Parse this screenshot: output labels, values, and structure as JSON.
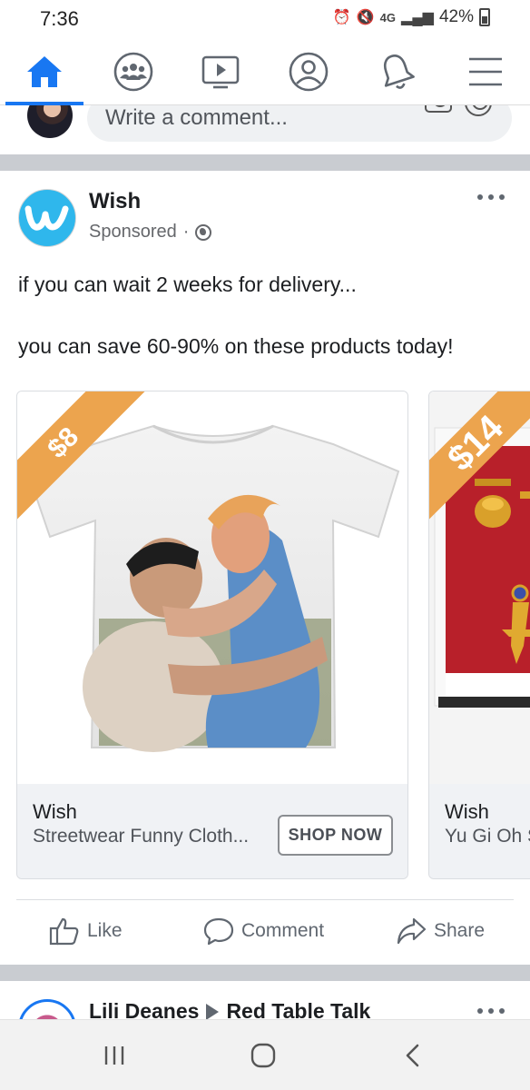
{
  "status_bar": {
    "time": "7:36",
    "network": "4G",
    "battery": "42%"
  },
  "nav": {
    "active": "home",
    "items": [
      "home-icon",
      "groups-icon",
      "watch-icon",
      "profile-icon",
      "notifications-icon",
      "menu-icon"
    ]
  },
  "comment_box": {
    "placeholder": "Write a comment..."
  },
  "post": {
    "page_name": "Wish",
    "sponsored": "Sponsored",
    "text_line1": "if you can wait 2 weeks for delivery...",
    "text_line2": "you can save 60-90% on these products today!",
    "cards": [
      {
        "price": "$8",
        "brand": "Wish",
        "title": "Streetwear Funny Cloth...",
        "cta": "SHOP NOW"
      },
      {
        "price": "$14",
        "brand": "Wish",
        "title": "Yu Gi Oh S"
      }
    ],
    "actions": {
      "like": "Like",
      "comment": "Comment",
      "share": "Share"
    }
  },
  "next_post": {
    "author": "Lili Deanes",
    "page": "Red Table Talk"
  },
  "colors": {
    "facebook_blue": "#1877f2",
    "wish_blue": "#2fb7ec",
    "price_ribbon": "#eca44e",
    "separator": "#c9ccd1"
  }
}
